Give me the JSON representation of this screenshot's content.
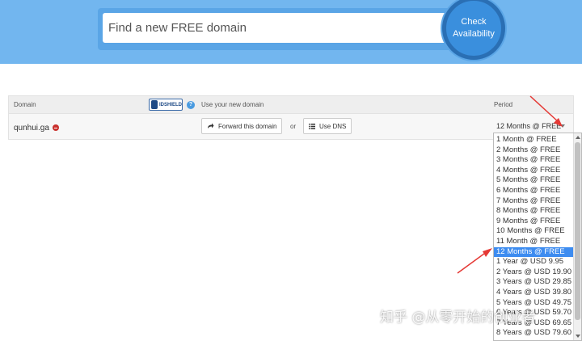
{
  "search": {
    "placeholder": "Find a new FREE domain",
    "button_line1": "Check",
    "button_line2": "Availability"
  },
  "table": {
    "headers": {
      "domain": "Domain",
      "use": "Use your new domain",
      "period": "Period"
    },
    "idshield_label": "IDSHIELD",
    "row": {
      "domain": "qunhui.ga",
      "forward_label": "Forward this domain",
      "or_label": "or",
      "dns_label": "Use DNS",
      "period_value": "12 Months @ FREE"
    }
  },
  "period_options": [
    "1 Month @ FREE",
    "2 Months @ FREE",
    "3 Months @ FREE",
    "4 Months @ FREE",
    "5 Months @ FREE",
    "6 Months @ FREE",
    "7 Months @ FREE",
    "8 Months @ FREE",
    "9 Months @ FREE",
    "10 Months @ FREE",
    "11 Month @ FREE",
    "12 Months @ FREE",
    "1 Year @ USD 9.95",
    "2 Years @ USD 19.90",
    "3 Years @ USD 29.85",
    "4 Years @ USD 39.80",
    "5 Years @ USD 49.75",
    "6 Years @ USD 59.70",
    "7 Years @ USD 69.65",
    "8 Years @ USD 79.60"
  ],
  "selected_option": "12 Months @ FREE",
  "watermark": "知乎 @从零开始的创业者",
  "colors": {
    "hero": "#72b6ef",
    "button": "#3a8fdd",
    "selected": "#3d8cf0",
    "annotation": "#e53935"
  }
}
